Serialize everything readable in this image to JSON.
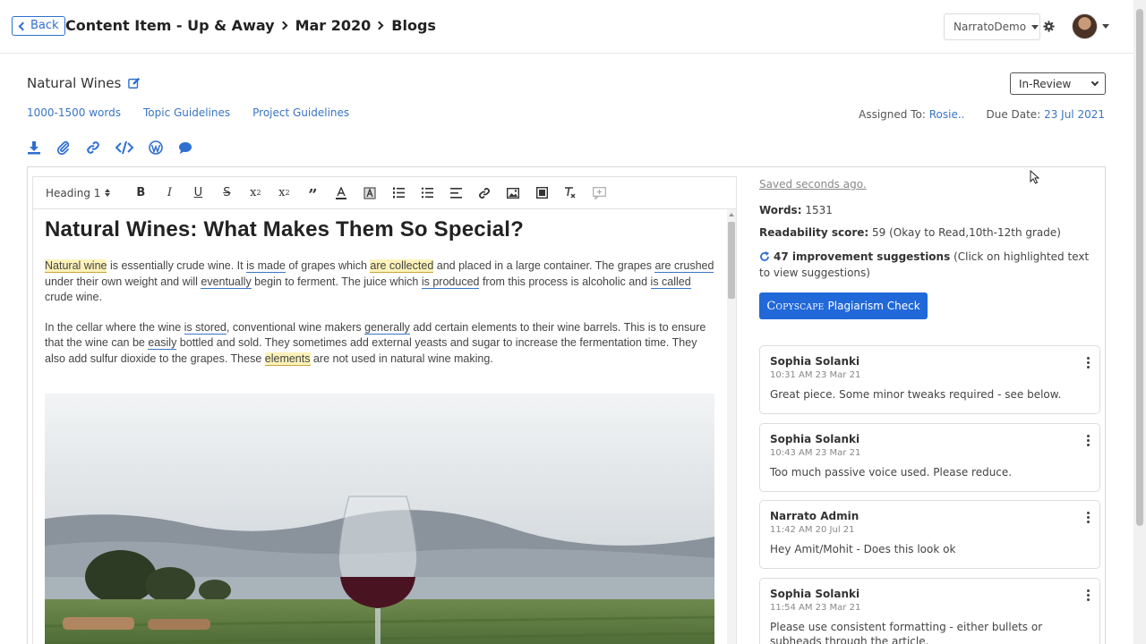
{
  "header": {
    "back_label": "Back",
    "breadcrumbs": [
      "Content Item - Up & Away",
      "Mar 2020",
      "Blogs"
    ],
    "account": "NarratoDemo"
  },
  "item": {
    "title": "Natural Wines",
    "links": [
      "1000-1500 words",
      "Topic Guidelines",
      "Project Guidelines"
    ],
    "status": "In-Review",
    "assigned_label": "Assigned To:",
    "assigned_value": "Rosie..",
    "due_label": "Due Date:",
    "due_value": "23 Jul 2021"
  },
  "toolbar": {
    "heading": "Heading 1"
  },
  "article": {
    "heading": "Natural Wines: What Makes Them So Special?",
    "p1": [
      {
        "t": "Natural wine",
        "s": "hl"
      },
      {
        "t": " is essentially crude wine. It ",
        "s": ""
      },
      {
        "t": "is made",
        "s": "ul"
      },
      {
        "t": " of grapes which ",
        "s": ""
      },
      {
        "t": "are collected",
        "s": "hl"
      },
      {
        "t": " and placed in a large container. The grapes ",
        "s": ""
      },
      {
        "t": "are crushed",
        "s": "ul"
      },
      {
        "t": " under their own weight and will ",
        "s": ""
      },
      {
        "t": "eventually",
        "s": "ul"
      },
      {
        "t": " begin to ferment. The juice which ",
        "s": ""
      },
      {
        "t": "is produced",
        "s": "ul"
      },
      {
        "t": " from this process is alcoholic and ",
        "s": ""
      },
      {
        "t": "is called",
        "s": "ul"
      },
      {
        "t": " crude wine.",
        "s": ""
      }
    ],
    "p2": [
      {
        "t": "In the cellar where the wine ",
        "s": ""
      },
      {
        "t": "is stored",
        "s": "ul"
      },
      {
        "t": ", conventional wine makers ",
        "s": ""
      },
      {
        "t": "generally",
        "s": "ul"
      },
      {
        "t": " add certain elements to their wine barrels. This is to ensure that the wine can be ",
        "s": ""
      },
      {
        "t": "easily",
        "s": "ul"
      },
      {
        "t": " bottled and sold. They sometimes add external yeasts and sugar to increase the fermentation time. They also add sulfur dioxide to the grapes. These ",
        "s": ""
      },
      {
        "t": "elements",
        "s": "hl"
      },
      {
        "t": " are not used in natural wine making.",
        "s": ""
      }
    ]
  },
  "panel": {
    "saved": "Saved seconds ago.",
    "words_label": "Words:",
    "words_value": "1531",
    "readability_label": "Readability score:",
    "readability_value": "59 (Okay to Read,10th-12th grade)",
    "suggestions_label": "47 improvement suggestions",
    "suggestions_note": "(Click on highlighted text to view suggestions)",
    "copyscape_logo": "Copyscape",
    "copyscape_label": "Plagiarism Check"
  },
  "comments": [
    {
      "author": "Sophia Solanki",
      "time": "10:31 AM 23 Mar 21",
      "body": "Great piece. Some minor tweaks required - see below."
    },
    {
      "author": "Sophia Solanki",
      "time": "10:43 AM 23 Mar 21",
      "body": "Too much passive voice used. Please reduce."
    },
    {
      "author": "Narrato Admin",
      "time": "11:42 AM 20 Jul 21",
      "body": "Hey Amit/Mohit - Does this look ok"
    },
    {
      "author": "Sophia Solanki",
      "time": "11:54 AM 23 Mar 21",
      "body": "Please use consistent formatting - either bullets or subheads through the article."
    }
  ],
  "icons": [
    "download-icon",
    "paperclip-icon",
    "link-icon",
    "code-icon",
    "wordpress-icon",
    "comment-icon",
    "gear-icon",
    "edit-icon",
    "refresh-icon"
  ]
}
